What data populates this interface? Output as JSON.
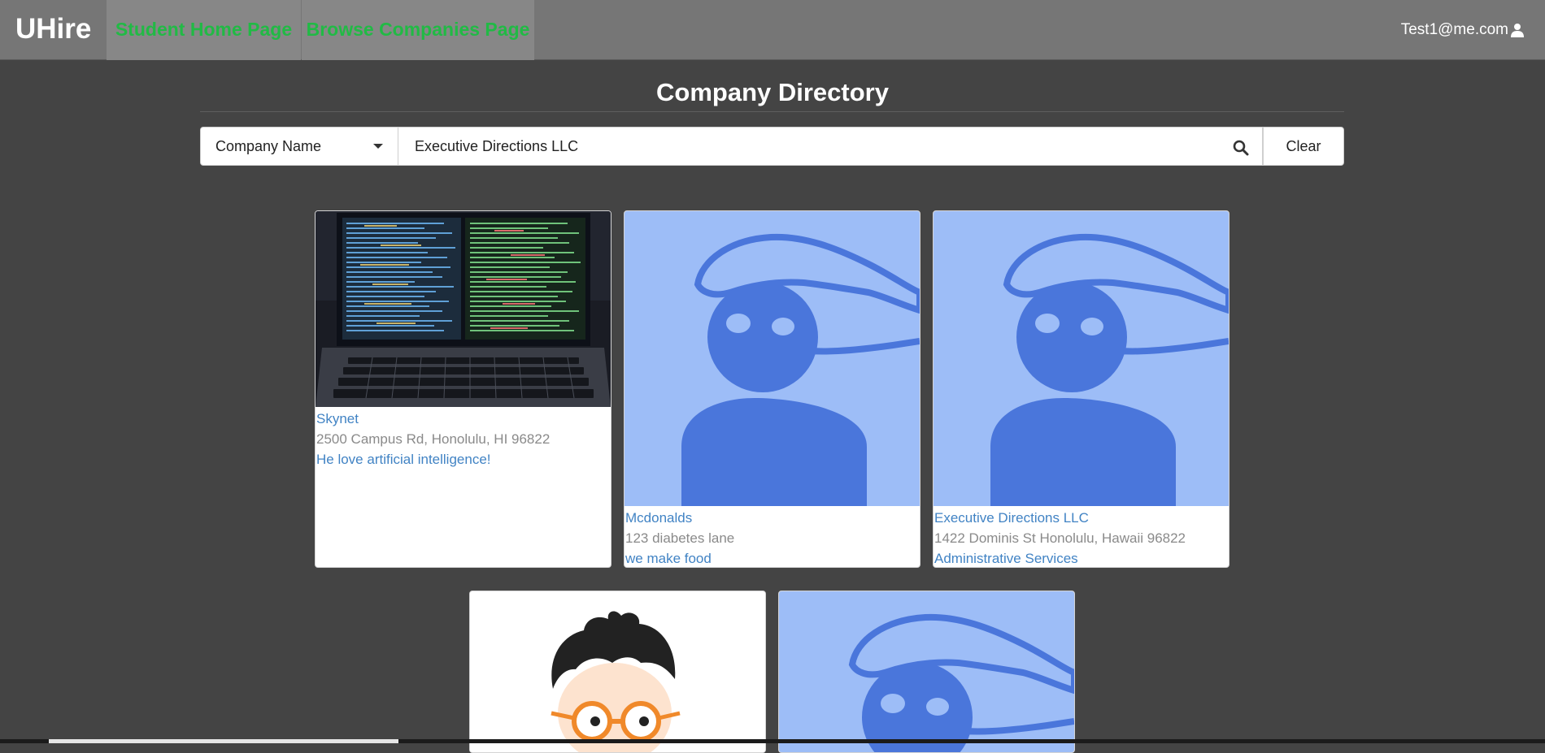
{
  "navbar": {
    "brand": "UHire",
    "items": [
      {
        "label": "Student Home Page"
      },
      {
        "label": "Browse Companies Page"
      }
    ],
    "user_email": "Test1@me.com",
    "link_color": "#21ba45"
  },
  "header": {
    "title": "Company Directory"
  },
  "search": {
    "filter_selected": "Company Name",
    "value": "Executive Directions LLC",
    "clear_label": "Clear"
  },
  "companies": [
    {
      "name": "Skynet",
      "address": "2500 Campus Rd, Honolulu, HI 96822",
      "description": "He love artificial intelligence!",
      "image": "laptop-code-photo"
    },
    {
      "name": "Mcdonalds",
      "address": "123 diabetes lane",
      "description": "we make food",
      "image": "default-avatar-illustration"
    },
    {
      "name": "Executive Directions LLC",
      "address": "1422 Dominis St Honolulu, Hawaii 96822",
      "description": "Administrative Services",
      "image": "default-avatar-illustration"
    },
    {
      "image": "cartoon-boy-with-glasses"
    },
    {
      "image": "default-avatar-illustration"
    }
  ],
  "colors": {
    "page_background": "#444444",
    "navbar_background": "#767676",
    "link_blue": "#4183c4",
    "avatar_light": "#9dbdf7",
    "avatar_dark": "#4a76db"
  }
}
